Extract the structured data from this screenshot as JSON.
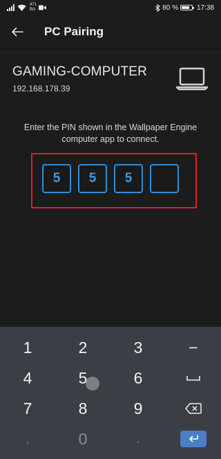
{
  "status_bar": {
    "net_speed_value": "471",
    "net_speed_unit": "B/s",
    "battery_percent_label": "80 %",
    "battery_level": 0.8,
    "time": "17:38"
  },
  "header": {
    "title": "PC Pairing",
    "back_icon": "arrow-left-icon"
  },
  "device": {
    "name": "GAMING-COMPUTER",
    "ip": "192.168.178.39",
    "icon": "laptop-icon"
  },
  "instructions": "Enter the PIN shown in the Wallpaper Engine computer app to connect.",
  "pin": {
    "digits": [
      "5",
      "5",
      "5",
      ""
    ],
    "box_color": "#2f8fd8",
    "highlight_color": "#e02020"
  },
  "keypad": {
    "keys": {
      "k1": "1",
      "k2": "2",
      "k3": "3",
      "minus": "−",
      "k4": "4",
      "k5": "5",
      "k6": "6",
      "space": "⎵",
      "k7": "7",
      "k8": "8",
      "k9": "9",
      "comma": ",",
      "k0": "0",
      "period": "."
    },
    "enter_color": "#4a7fc8",
    "background": "#3b3e44"
  }
}
